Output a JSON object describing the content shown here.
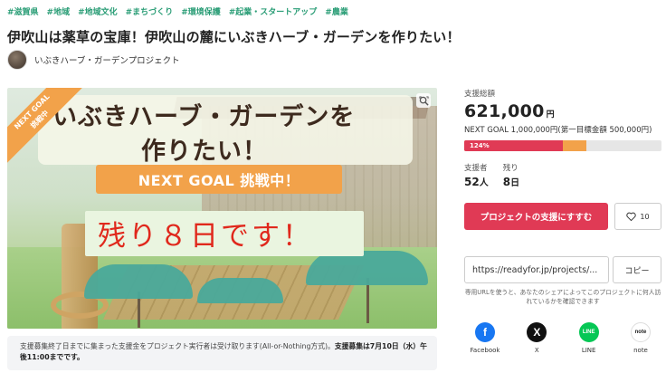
{
  "tags": [
    "#滋賀県",
    "#地域",
    "#地域文化",
    "#まちづくり",
    "#環境保護",
    "#起業・スタートアップ",
    "#農業"
  ],
  "project": {
    "title": "伊吹山は薬草の宝庫！伊吹山の麓にいぶきハーブ・ガーデンを作りたい！",
    "owner_name": "いぶきハーブ・ガーデンプロジェクト"
  },
  "hero": {
    "ribbon": "NEXT GOAL\n挑戦中",
    "headline_line1": "いぶきハーブ・ガーデンを",
    "headline_line2": "作りたい！",
    "banner": "NEXT GOAL 挑戦中！",
    "remaining": "残り８日です！"
  },
  "notice": {
    "text_before": "支援募集終了日までに集まった支援金をプロジェクト実行者は受け取ります(All-or-Nothing方式)。",
    "text_bold": "支援募集は7月10日（水）午後11:00までです。"
  },
  "funding": {
    "total_label": "支援総額",
    "amount": "621,000",
    "unit": "円",
    "goal_text": "NEXT GOAL 1,000,000円(第一目標金額 500,000円)",
    "progress_percent_label": "124%",
    "progress_next_goal_fraction": 0.621,
    "supporters_label": "支援者",
    "supporters_value": "52",
    "supporters_unit": "人",
    "remaining_label": "残り",
    "remaining_value": "8",
    "remaining_unit": "日"
  },
  "actions": {
    "support_button": "プロジェクトの支援にすすむ",
    "favorite_count": "10",
    "share_url": "https://readyfor.jp/projects/...",
    "copy_button": "コピー",
    "url_note": "専用URLを使うと、あなたのシェアによってこのプロジェクトに何人訪れているかを確認できます"
  },
  "share": [
    {
      "label": "Facebook",
      "glyph": "f"
    },
    {
      "label": "X",
      "glyph": "X"
    },
    {
      "label": "LINE",
      "glyph": "LINE"
    },
    {
      "label": "note",
      "glyph": "note"
    }
  ],
  "colors": {
    "accent": "#e03a55",
    "tag": "#2a9d76",
    "next_goal": "#f2a24a"
  }
}
